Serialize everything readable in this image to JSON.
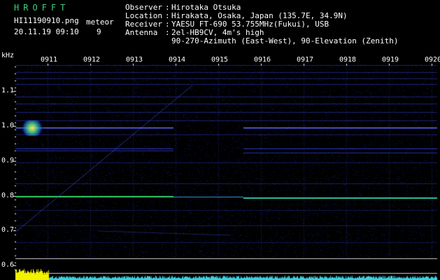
{
  "app": {
    "name": "HROFFT"
  },
  "file": {
    "name": "HI11190910.png",
    "datetime": "20.11.19 09:10"
  },
  "detection": {
    "label": "meteor",
    "count": "9"
  },
  "station": {
    "observer_label": "Observer",
    "observer": "Hirotaka Otsuka",
    "location_label": "Location",
    "location": "Hirakata, Osaka, Japan (135.7E, 34.9N)",
    "receiver_label": "Receiver",
    "receiver": "YAESU FT-690 53.755MHz(Fukui), USB",
    "antenna_label": "Antenna",
    "antenna_line1": "2el-HB9CV, 4m's high",
    "antenna_line2": "90-270-Azimuth (East-West), 90-Elevation (Zenith)"
  },
  "y_axis": {
    "unit": "kHz",
    "ticks": [
      "1.1",
      "1.0",
      "0.9",
      "0.8",
      "0.7",
      "0.6"
    ]
  },
  "x_axis": {
    "ticks": [
      "0911",
      "0912",
      "0913",
      "0914",
      "0915",
      "0916",
      "0917",
      "0918",
      "0919",
      "0920"
    ]
  },
  "colors": {
    "background": "#000000",
    "title": "#3fd07a",
    "carrier": "#37d26a",
    "band": "#2a3cff",
    "level": "#f2f200"
  }
}
